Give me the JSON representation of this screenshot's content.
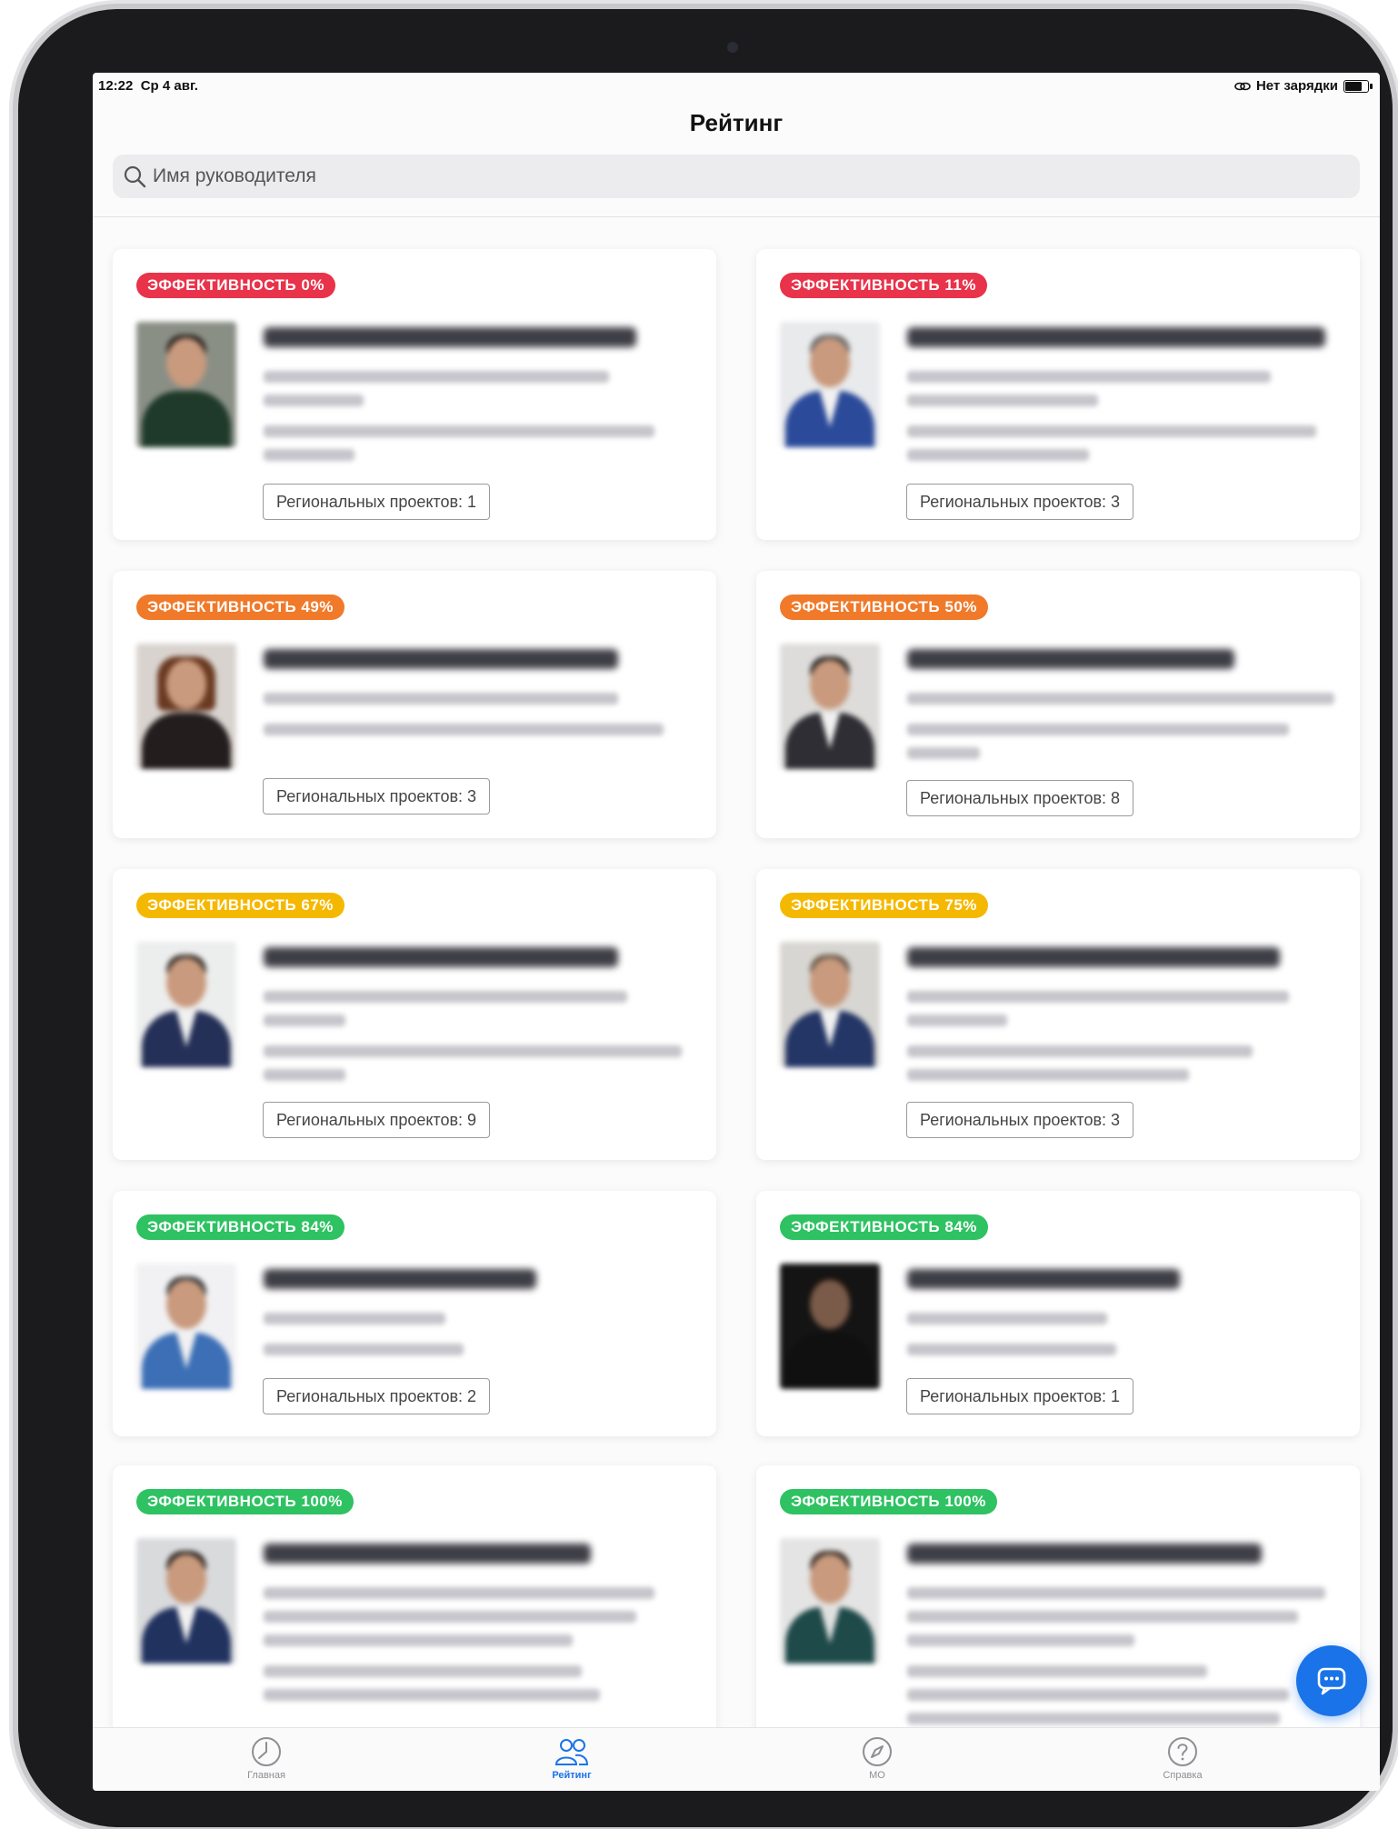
{
  "status_bar": {
    "time": "12:22",
    "date": "Ср 4 авг.",
    "charging": "Нет зарядки"
  },
  "page": {
    "title": "Рейтинг"
  },
  "search": {
    "placeholder": "Имя руководителя"
  },
  "cards": [
    {
      "efficiency": "ЭФФЕКТИВНОСТЬ 0%",
      "projects": "Региональных проектов: 1"
    },
    {
      "efficiency": "ЭФФЕКТИВНОСТЬ 11%",
      "projects": "Региональных проектов: 3"
    },
    {
      "efficiency": "ЭФФЕКТИВНОСТЬ 49%",
      "projects": "Региональных проектов: 3"
    },
    {
      "efficiency": "ЭФФЕКТИВНОСТЬ 50%",
      "projects": "Региональных проектов: 8"
    },
    {
      "efficiency": "ЭФФЕКТИВНОСТЬ 67%",
      "projects": "Региональных проектов: 9"
    },
    {
      "efficiency": "ЭФФЕКТИВНОСТЬ 75%",
      "projects": "Региональных проектов: 3"
    },
    {
      "efficiency": "ЭФФЕКТИВНОСТЬ 84%",
      "projects": "Региональных проектов: 2"
    },
    {
      "efficiency": "ЭФФЕКТИВНОСТЬ 84%",
      "projects": "Региональных проектов: 1"
    },
    {
      "efficiency": "ЭФФЕКТИВНОСТЬ 100%",
      "projects": ""
    },
    {
      "efficiency": "ЭФФЕКТИВНОСТЬ 100%",
      "projects": ""
    }
  ],
  "badge_colors": {
    "red": "#e8334a",
    "orange": "#f07a2a",
    "yellow": "#f5b800",
    "green": "#2ec262"
  },
  "tabbar": {
    "tabs": [
      {
        "label": "Главная",
        "icon": "clock-icon"
      },
      {
        "label": "Рейтинг",
        "icon": "users-icon",
        "active": true
      },
      {
        "label": "МО",
        "icon": "compass-icon"
      },
      {
        "label": "Справка",
        "icon": "help-icon"
      }
    ]
  },
  "fab": {
    "icon": "chat-icon"
  }
}
